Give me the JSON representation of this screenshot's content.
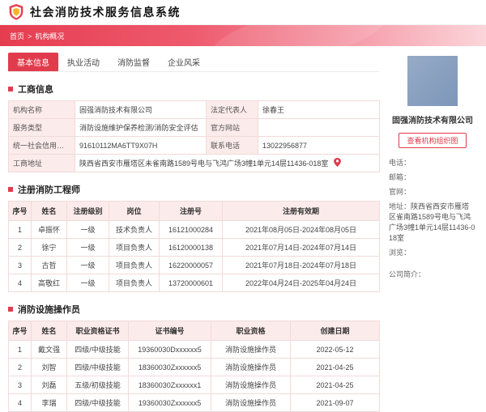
{
  "app": {
    "title": "社会消防技术服务信息系统"
  },
  "breadcrumb": {
    "home": "首页",
    "separator": ">",
    "current": "机构概况"
  },
  "tabs": [
    {
      "label": "基本信息",
      "active": true
    },
    {
      "label": "执业活动",
      "active": false
    },
    {
      "label": "消防监督",
      "active": false
    },
    {
      "label": "企业风采",
      "active": false
    }
  ],
  "business": {
    "section_title": "工商信息",
    "rows": [
      {
        "label1": "机构名称",
        "value1": "固强消防技术有限公司",
        "label2": "法定代表人",
        "value2": "徐春王"
      },
      {
        "label1": "服务类型",
        "value1": "消防设施维护保养检测/消防安全评估",
        "label2": "官方网站",
        "value2": ""
      },
      {
        "label1": "统一社会信用代码",
        "value1": "91610112MA6TT9X07H",
        "label2": "联系电话",
        "value2": "13022956877"
      }
    ],
    "address_label": "工商地址",
    "address_value": "陕西省西安市雁塔区未雀南路1589号电与飞鸿广场3幢1单元14层11436-018室"
  },
  "engineers": {
    "section_title": "注册消防工程师",
    "headers": [
      "序号",
      "姓名",
      "注册级别",
      "岗位",
      "注册号",
      "注册有效期"
    ],
    "rows": [
      [
        "1",
        "卓振怀",
        "一级",
        "技术负责人",
        "16121000284",
        "2021年08月05日-2024年08月05日"
      ],
      [
        "2",
        "徐宁",
        "一级",
        "项目负责人",
        "16120000138",
        "2021年07月14日-2024年07月14日"
      ],
      [
        "3",
        "古哲",
        "一级",
        "项目负责人",
        "16220000057",
        "2021年07月18日-2024年07月18日"
      ],
      [
        "4",
        "高敬红",
        "一级",
        "项目负责人",
        "13720000601",
        "2022年04月24日-2025年04月24日"
      ]
    ]
  },
  "operators": {
    "section_title": "消防设施操作员",
    "headers": [
      "序号",
      "姓名",
      "职业资格证书",
      "证书编号",
      "职业资格",
      "创建日期"
    ],
    "rows": [
      [
        "1",
        "戴文强",
        "四级/中级技能",
        "19360030Dxxxxxx5",
        "消防设施操作员",
        "2022-05-12"
      ],
      [
        "2",
        "刘智",
        "四级/中级技能",
        "18360030Zxxxxxx5",
        "消防设施操作员",
        "2021-04-25"
      ],
      [
        "3",
        "刘磊",
        "五级/初级技能",
        "18360030Zxxxxxx1",
        "消防设施操作员",
        "2021-04-25"
      ],
      [
        "4",
        "李瑞",
        "四级/中级技能",
        "19360030Zxxxxxx5",
        "消防设施操作员",
        "2021-09-07"
      ]
    ]
  },
  "sidebar": {
    "company_name": "固强消防技术有限公司",
    "org_button": "查看机构组织图",
    "fields": [
      {
        "label": "电话：",
        "value": ""
      },
      {
        "label": "邮箱：",
        "value": ""
      },
      {
        "label": "官网：",
        "value": ""
      },
      {
        "label": "地址：",
        "value": "陕西省西安市雁塔区雀南路1589号电与飞鸿广场3幢1单元14层11436-018室"
      },
      {
        "label": "浏览：",
        "value": ""
      },
      {
        "label": "公司简介：",
        "value": ""
      }
    ]
  },
  "colors": {
    "accent_red": "#e13c4d",
    "banner_gradient_start": "#e63c50",
    "banner_gradient_end": "#fbd6da",
    "table_header_bg": "#fcebeb",
    "table_border": "#f1dada",
    "logo_blue": "#87a0c0",
    "shield_gold": "#f7b32b"
  }
}
